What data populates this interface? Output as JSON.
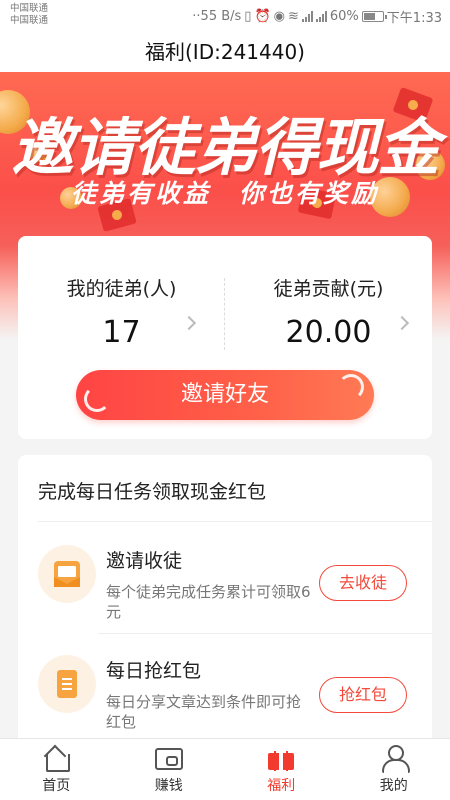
{
  "status_bar": {
    "carrier_1": "中国联通",
    "carrier_2": "中国联通",
    "speed": "··55 B/s",
    "battery": "60%",
    "time": "下午1:33"
  },
  "title": "福利(ID:241440)",
  "banner": {
    "title": "邀请徒弟得现金",
    "subtitle": "徒弟有收益　你也有奖励"
  },
  "stats": {
    "apprentices_label": "我的徒弟(人)",
    "apprentices_value": "17",
    "contribution_label": "徒弟贡献(元)",
    "contribution_value": "20.00",
    "invite_button": "邀请好友"
  },
  "tasks": {
    "heading": "完成每日任务领取现金红包",
    "items": [
      {
        "icon": "mail-icon",
        "name": "邀请收徒",
        "desc": "每个徒弟完成任务累计可领取6元",
        "button": "去收徒"
      },
      {
        "icon": "note-icon",
        "name": "每日抢红包",
        "desc": "每日分享文章达到条件即可抢红包",
        "button": "抢红包"
      }
    ]
  },
  "nav": {
    "items": [
      {
        "label": "首页",
        "icon": "home-icon"
      },
      {
        "label": "赚钱",
        "icon": "wallet-icon"
      },
      {
        "label": "福利",
        "icon": "gift-icon"
      },
      {
        "label": "我的",
        "icon": "user-icon"
      }
    ],
    "active_color": "#f33a2e"
  },
  "colors": {
    "accent": "#f44a3c",
    "banner": "#fb4f4a"
  }
}
